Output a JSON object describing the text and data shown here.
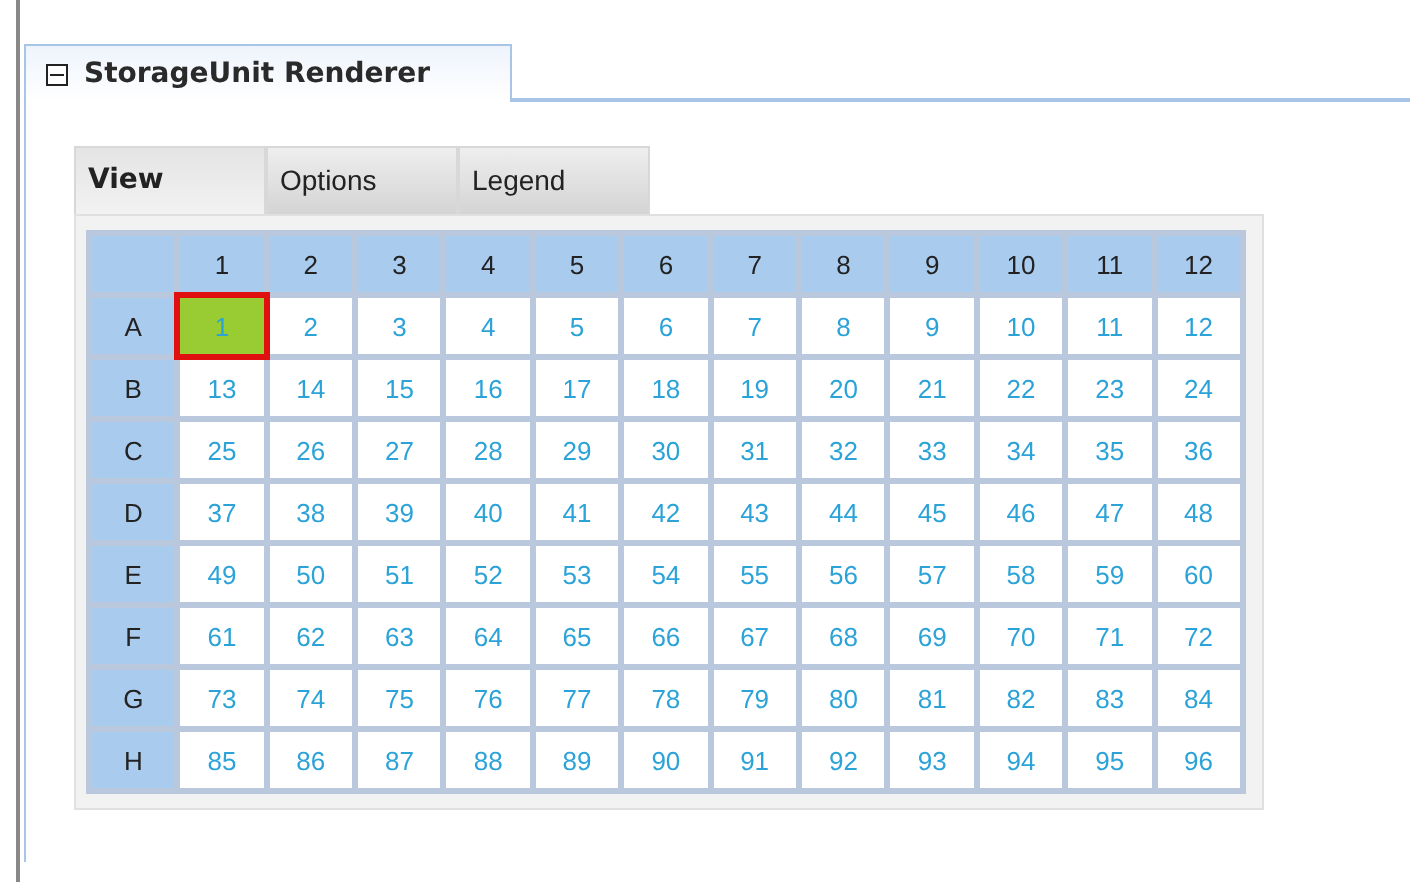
{
  "panel": {
    "title": "StorageUnit Renderer",
    "expanded": true
  },
  "tabs": [
    {
      "label": "View",
      "selected": true
    },
    {
      "label": "Options",
      "selected": false
    },
    {
      "label": "Legend",
      "selected": false
    }
  ],
  "grid": {
    "columns": [
      "1",
      "2",
      "3",
      "4",
      "5",
      "6",
      "7",
      "8",
      "9",
      "10",
      "11",
      "12"
    ],
    "rows": [
      {
        "label": "A",
        "cells": [
          {
            "text": "1",
            "selected": true
          },
          {
            "text": "2",
            "selected": false
          },
          {
            "text": "3",
            "selected": false
          },
          {
            "text": "4",
            "selected": false
          },
          {
            "text": "5",
            "selected": false
          },
          {
            "text": "6",
            "selected": false
          },
          {
            "text": "7",
            "selected": false
          },
          {
            "text": "8",
            "selected": false
          },
          {
            "text": "9",
            "selected": false
          },
          {
            "text": "10",
            "selected": false
          },
          {
            "text": "11",
            "selected": false
          },
          {
            "text": "12",
            "selected": false
          }
        ]
      },
      {
        "label": "B",
        "cells": [
          {
            "text": "13",
            "selected": false
          },
          {
            "text": "14",
            "selected": false
          },
          {
            "text": "15",
            "selected": false
          },
          {
            "text": "16",
            "selected": false
          },
          {
            "text": "17",
            "selected": false
          },
          {
            "text": "18",
            "selected": false
          },
          {
            "text": "19",
            "selected": false
          },
          {
            "text": "20",
            "selected": false
          },
          {
            "text": "21",
            "selected": false
          },
          {
            "text": "22",
            "selected": false
          },
          {
            "text": "23",
            "selected": false
          },
          {
            "text": "24",
            "selected": false
          }
        ]
      },
      {
        "label": "C",
        "cells": [
          {
            "text": "25",
            "selected": false
          },
          {
            "text": "26",
            "selected": false
          },
          {
            "text": "27",
            "selected": false
          },
          {
            "text": "28",
            "selected": false
          },
          {
            "text": "29",
            "selected": false
          },
          {
            "text": "30",
            "selected": false
          },
          {
            "text": "31",
            "selected": false
          },
          {
            "text": "32",
            "selected": false
          },
          {
            "text": "33",
            "selected": false
          },
          {
            "text": "34",
            "selected": false
          },
          {
            "text": "35",
            "selected": false
          },
          {
            "text": "36",
            "selected": false
          }
        ]
      },
      {
        "label": "D",
        "cells": [
          {
            "text": "37",
            "selected": false
          },
          {
            "text": "38",
            "selected": false
          },
          {
            "text": "39",
            "selected": false
          },
          {
            "text": "40",
            "selected": false
          },
          {
            "text": "41",
            "selected": false
          },
          {
            "text": "42",
            "selected": false
          },
          {
            "text": "43",
            "selected": false
          },
          {
            "text": "44",
            "selected": false
          },
          {
            "text": "45",
            "selected": false
          },
          {
            "text": "46",
            "selected": false
          },
          {
            "text": "47",
            "selected": false
          },
          {
            "text": "48",
            "selected": false
          }
        ]
      },
      {
        "label": "E",
        "cells": [
          {
            "text": "49",
            "selected": false
          },
          {
            "text": "50",
            "selected": false
          },
          {
            "text": "51",
            "selected": false
          },
          {
            "text": "52",
            "selected": false
          },
          {
            "text": "53",
            "selected": false
          },
          {
            "text": "54",
            "selected": false
          },
          {
            "text": "55",
            "selected": false
          },
          {
            "text": "56",
            "selected": false
          },
          {
            "text": "57",
            "selected": false
          },
          {
            "text": "58",
            "selected": false
          },
          {
            "text": "59",
            "selected": false
          },
          {
            "text": "60",
            "selected": false
          }
        ]
      },
      {
        "label": "F",
        "cells": [
          {
            "text": "61",
            "selected": false
          },
          {
            "text": "62",
            "selected": false
          },
          {
            "text": "63",
            "selected": false
          },
          {
            "text": "64",
            "selected": false
          },
          {
            "text": "65",
            "selected": false
          },
          {
            "text": "66",
            "selected": false
          },
          {
            "text": "67",
            "selected": false
          },
          {
            "text": "68",
            "selected": false
          },
          {
            "text": "69",
            "selected": false
          },
          {
            "text": "70",
            "selected": false
          },
          {
            "text": "71",
            "selected": false
          },
          {
            "text": "72",
            "selected": false
          }
        ]
      },
      {
        "label": "G",
        "cells": [
          {
            "text": "73",
            "selected": false
          },
          {
            "text": "74",
            "selected": false
          },
          {
            "text": "75",
            "selected": false
          },
          {
            "text": "76",
            "selected": false
          },
          {
            "text": "77",
            "selected": false
          },
          {
            "text": "78",
            "selected": false
          },
          {
            "text": "79",
            "selected": false
          },
          {
            "text": "80",
            "selected": false
          },
          {
            "text": "81",
            "selected": false
          },
          {
            "text": "82",
            "selected": false
          },
          {
            "text": "83",
            "selected": false
          },
          {
            "text": "84",
            "selected": false
          }
        ]
      },
      {
        "label": "H",
        "cells": [
          {
            "text": "85",
            "selected": false
          },
          {
            "text": "86",
            "selected": false
          },
          {
            "text": "87",
            "selected": false
          },
          {
            "text": "88",
            "selected": false
          },
          {
            "text": "89",
            "selected": false
          },
          {
            "text": "90",
            "selected": false
          },
          {
            "text": "91",
            "selected": false
          },
          {
            "text": "92",
            "selected": false
          },
          {
            "text": "93",
            "selected": false
          },
          {
            "text": "94",
            "selected": false
          },
          {
            "text": "95",
            "selected": false
          },
          {
            "text": "96",
            "selected": false
          }
        ]
      }
    ]
  }
}
